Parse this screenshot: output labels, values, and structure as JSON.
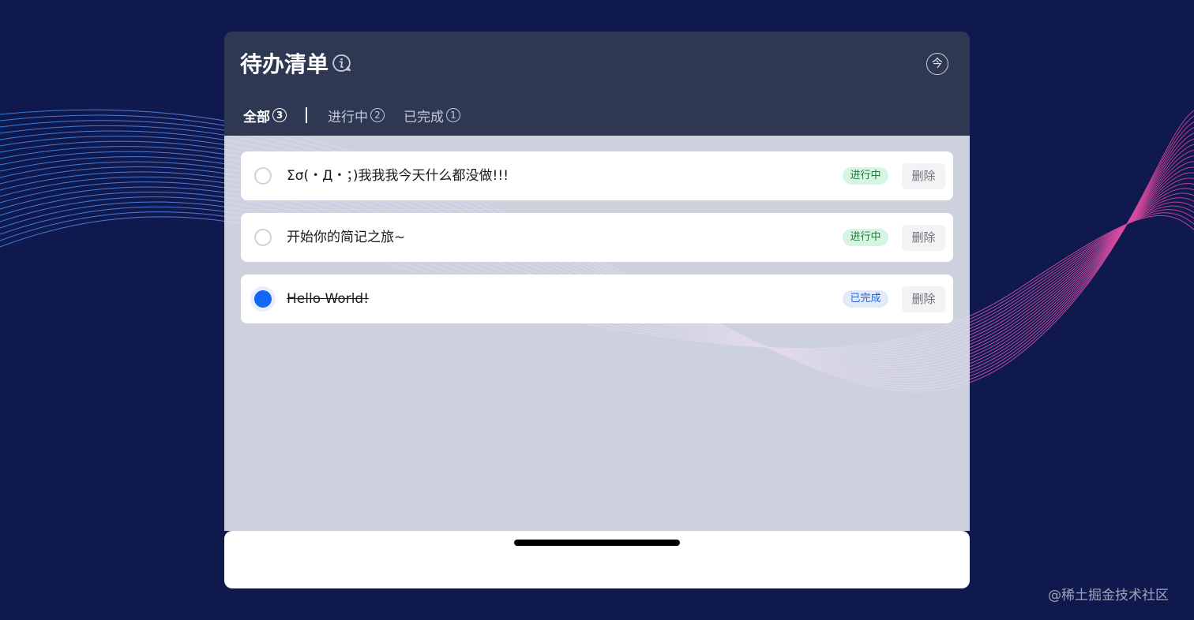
{
  "header": {
    "title": "待办清单",
    "today_label": "今"
  },
  "tabs": [
    {
      "label": "全部",
      "count": "3",
      "active": true
    },
    {
      "label": "进行中",
      "count": "2",
      "active": false
    },
    {
      "label": "已完成",
      "count": "1",
      "active": false
    }
  ],
  "todos": [
    {
      "text": "Σσ(・Д・；)我我我今天什么都没做!!!",
      "status": "进行中",
      "done": false,
      "delete_label": "删除"
    },
    {
      "text": "开始你的简记之旅~",
      "status": "进行中",
      "done": false,
      "delete_label": "删除"
    },
    {
      "text": "Hello World!",
      "status": "已完成",
      "done": true,
      "delete_label": "删除"
    }
  ],
  "watermark": "@稀土掘金技术社区",
  "colors": {
    "background": "#10194d",
    "header": "#2e3853",
    "accent": "#1366f6",
    "progress_badge": "#d6f5e2",
    "completed_badge": "#e3ebfb"
  },
  "icons": {
    "info": "info-icon",
    "check_done": "check-filled-icon",
    "check_empty": "check-empty-icon"
  }
}
